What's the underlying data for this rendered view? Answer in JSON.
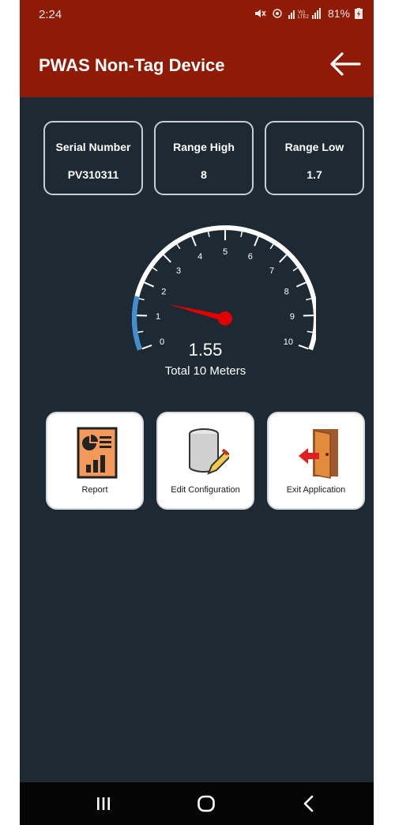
{
  "status_bar": {
    "time": "2:24",
    "battery": "81%"
  },
  "app_bar": {
    "title": "PWAS Non-Tag Device",
    "back_icon": "arrow-left-icon"
  },
  "info_cards": [
    {
      "label": "Serial Number",
      "value": "PV310311"
    },
    {
      "label": "Range High",
      "value": "8"
    },
    {
      "label": "Range Low",
      "value": "1.7"
    }
  ],
  "gauge": {
    "value": 1.55,
    "value_text": "1.55",
    "caption": "Total 10 Meters",
    "min": 0,
    "max": 10,
    "ticks": [
      "0",
      "1",
      "2",
      "3",
      "4",
      "5",
      "6",
      "7",
      "8",
      "9",
      "10"
    ],
    "colors": {
      "arc": "#ffffff",
      "progress": "#3f8fd3",
      "needle": "#e00000"
    }
  },
  "actions": [
    {
      "label": "Report",
      "icon": "report-chart-icon"
    },
    {
      "label": "Edit Configuration",
      "icon": "database-edit-icon"
    },
    {
      "label": "Exit Application",
      "icon": "exit-door-icon"
    }
  ],
  "colors": {
    "header": "#8f1b06",
    "background": "#1e2a33"
  }
}
